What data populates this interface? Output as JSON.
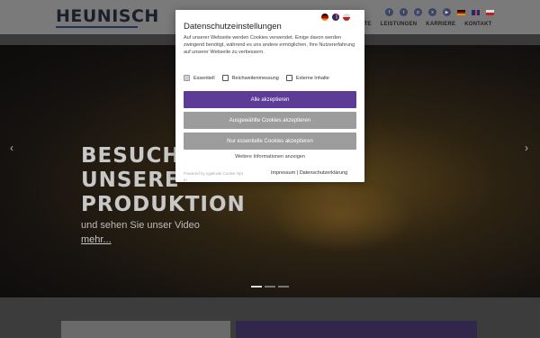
{
  "header": {
    "logo": "HEUNISCH",
    "social_icons": [
      "facebook-icon",
      "twitter-icon",
      "pinterest-icon",
      "xing-icon",
      "youtube-icon"
    ],
    "flags": [
      "de",
      "gb",
      "cz"
    ],
    "nav": [
      "KTE",
      "LEISTUNGEN",
      "KARRIERE",
      "KONTAKT"
    ]
  },
  "hero": {
    "title_line1": "BESUCHE",
    "title_line2": "UNSERE",
    "title_line3": "PRODUKTION",
    "subtitle": "und sehen Sie unser Video",
    "more": "mehr...",
    "arrow_left": "‹",
    "arrow_right": "›"
  },
  "cookie": {
    "title": "Datenschutzeinstellungen",
    "text": "Auf unserer Webseite werden Cookies verwendet. Einige davon werden zwingend benötigt, während es uns andere ermöglichen, Ihre Nutzererfahrung auf unserer Webseite zu verbessern.",
    "options": [
      {
        "label": "Essentiell",
        "checked": true
      },
      {
        "label": "Reichweitenmessung",
        "checked": false
      },
      {
        "label": "Externe Inhalte",
        "checked": false
      }
    ],
    "accept_all": "Alle akzeptieren",
    "accept_selected": "Ausgewählte Cookies akzeptieren",
    "accept_essential": "Nur essentielle Cookies akzeptieren",
    "more_info": "Weitere Informationen anzeigen",
    "powered_by": "Powered by sgalinski Cookie Opt In",
    "imprint": "Impressum",
    "separator": "|",
    "privacy": "Datenschutzerklärung"
  },
  "colors": {
    "primary": "#5c3c96",
    "secondary_button": "#9c9c9c",
    "logo_bar": "#25305a"
  }
}
